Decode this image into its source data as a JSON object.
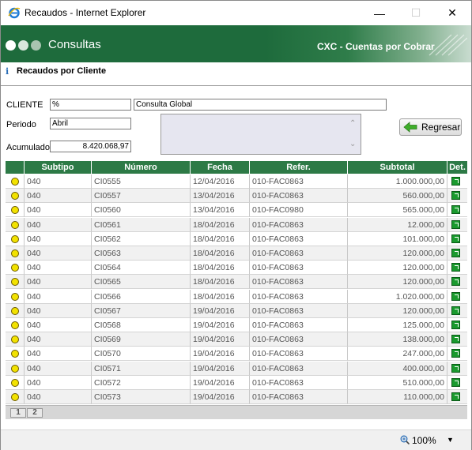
{
  "window": {
    "title": "Recaudos - Internet Explorer"
  },
  "header": {
    "title": "Consultas",
    "subtitle": "CXC - Cuentas por Cobrar"
  },
  "section": {
    "title": "Recaudos por Cliente"
  },
  "form": {
    "cliente_label": "CLIENTE",
    "cliente_code": "%",
    "cliente_name": "Consulta Global",
    "periodo_label": "Periodo",
    "periodo_value": "Abril",
    "acumulado_label": "Acumulado",
    "acumulado_value": "8.420.068,97",
    "regresar_label": "Regresar"
  },
  "table": {
    "headers": [
      "",
      "Subtipo",
      "Número",
      "Fecha",
      "Refer.",
      "Subtotal",
      "Det."
    ],
    "rows": [
      {
        "subtipo": "040",
        "numero": "CI0555",
        "fecha": "12/04/2016",
        "refer": "010-FAC0863",
        "subtotal": "1.000.000,00"
      },
      {
        "subtipo": "040",
        "numero": "CI0557",
        "fecha": "13/04/2016",
        "refer": "010-FAC0863",
        "subtotal": "560.000,00"
      },
      {
        "subtipo": "040",
        "numero": "CI0560",
        "fecha": "13/04/2016",
        "refer": "010-FAC0980",
        "subtotal": "565.000,00"
      },
      {
        "subtipo": "040",
        "numero": "CI0561",
        "fecha": "18/04/2016",
        "refer": "010-FAC0863",
        "subtotal": "12.000,00"
      },
      {
        "subtipo": "040",
        "numero": "CI0562",
        "fecha": "18/04/2016",
        "refer": "010-FAC0863",
        "subtotal": "101.000,00"
      },
      {
        "subtipo": "040",
        "numero": "CI0563",
        "fecha": "18/04/2016",
        "refer": "010-FAC0863",
        "subtotal": "120.000,00"
      },
      {
        "subtipo": "040",
        "numero": "CI0564",
        "fecha": "18/04/2016",
        "refer": "010-FAC0863",
        "subtotal": "120.000,00"
      },
      {
        "subtipo": "040",
        "numero": "CI0565",
        "fecha": "18/04/2016",
        "refer": "010-FAC0863",
        "subtotal": "120.000,00"
      },
      {
        "subtipo": "040",
        "numero": "CI0566",
        "fecha": "18/04/2016",
        "refer": "010-FAC0863",
        "subtotal": "1.020.000,00"
      },
      {
        "subtipo": "040",
        "numero": "CI0567",
        "fecha": "19/04/2016",
        "refer": "010-FAC0863",
        "subtotal": "120.000,00"
      },
      {
        "subtipo": "040",
        "numero": "CI0568",
        "fecha": "19/04/2016",
        "refer": "010-FAC0863",
        "subtotal": "125.000,00"
      },
      {
        "subtipo": "040",
        "numero": "CI0569",
        "fecha": "19/04/2016",
        "refer": "010-FAC0863",
        "subtotal": "138.000,00"
      },
      {
        "subtipo": "040",
        "numero": "CI0570",
        "fecha": "19/04/2016",
        "refer": "010-FAC0863",
        "subtotal": "247.000,00"
      },
      {
        "subtipo": "040",
        "numero": "CI0571",
        "fecha": "19/04/2016",
        "refer": "010-FAC0863",
        "subtotal": "400.000,00"
      },
      {
        "subtipo": "040",
        "numero": "CI0572",
        "fecha": "19/04/2016",
        "refer": "010-FAC0863",
        "subtotal": "510.000,00"
      },
      {
        "subtipo": "040",
        "numero": "CI0573",
        "fecha": "19/04/2016",
        "refer": "010-FAC0863",
        "subtotal": "110.000,00"
      }
    ],
    "pages": [
      "1",
      "2"
    ]
  },
  "statusbar": {
    "zoom": "100%"
  },
  "colors": {
    "header_green": "#1e6b3c",
    "grid_header": "#2d7a46",
    "status_dot": "#f2e200"
  }
}
